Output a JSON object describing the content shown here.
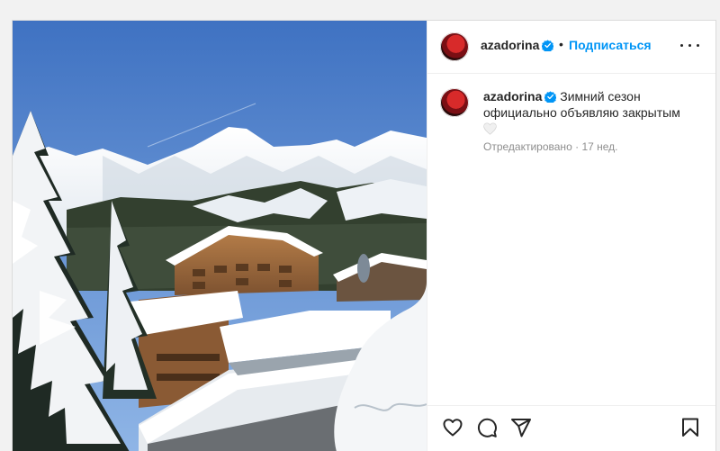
{
  "post": {
    "username": "azadorina",
    "separator": "•",
    "follow_label": "Подписаться",
    "caption_text": "Зимний сезон официально объявляю закрытым",
    "edited_label": "Отредактировано",
    "meta_separator": "·",
    "time_ago": "17 нед.",
    "verified_color": "#0095f6",
    "accent_color": "#0095f6"
  },
  "icons": {
    "more": "more-options-icon",
    "like": "heart-icon",
    "comment": "comment-icon",
    "share": "send-icon",
    "save": "bookmark-icon"
  }
}
